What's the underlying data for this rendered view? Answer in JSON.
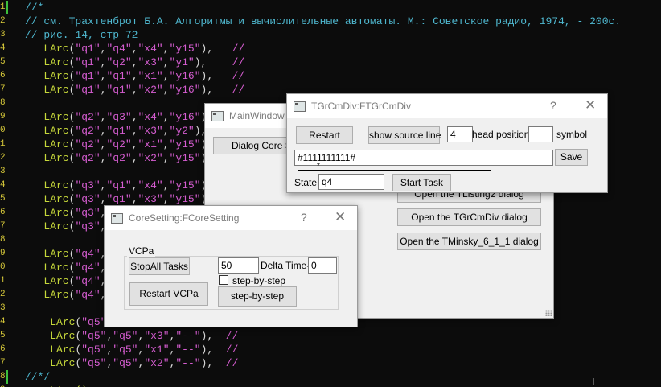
{
  "editor": {
    "lines": [
      {
        "ind": "",
        "t": "cmt",
        "text": "//*"
      },
      {
        "ind": "",
        "t": "cmt",
        "text": "// см. Трахтенброт Б.А. Алгоритмы и вычислительные автоматы. М.: Советское радио, 1974, - 200с."
      },
      {
        "ind": "",
        "t": "cmt",
        "text": "// рис. 14, стр 72"
      },
      {
        "ind": "   ",
        "t": "arc",
        "args": [
          "\"q1\"",
          "\"q4\"",
          "\"x4\"",
          "\"y15\""
        ],
        "sp": "   "
      },
      {
        "ind": "   ",
        "t": "arc",
        "args": [
          "\"q1\"",
          "\"q2\"",
          "\"x3\"",
          "\"y1\""
        ],
        "sp": "    "
      },
      {
        "ind": "   ",
        "t": "arc",
        "args": [
          "\"q1\"",
          "\"q1\"",
          "\"x1\"",
          "\"y16\""
        ],
        "sp": "   "
      },
      {
        "ind": "   ",
        "t": "arc",
        "args": [
          "\"q1\"",
          "\"q1\"",
          "\"x2\"",
          "\"y16\""
        ],
        "sp": "   "
      },
      {
        "ind": "",
        "t": "blank"
      },
      {
        "ind": "   ",
        "t": "arc",
        "args": [
          "\"q2\"",
          "\"q3\"",
          "\"x4\"",
          "\"y16\""
        ],
        "sp": "   "
      },
      {
        "ind": "   ",
        "t": "arc",
        "args": [
          "\"q2\"",
          "\"q1\"",
          "\"x3\"",
          "\"y2\""
        ],
        "sp": "    "
      },
      {
        "ind": "   ",
        "t": "arc",
        "args": [
          "\"q2\"",
          "\"q2\"",
          "\"x1\"",
          "\"y15\""
        ],
        "sp": "   "
      },
      {
        "ind": "   ",
        "t": "arc",
        "args": [
          "\"q2\"",
          "\"q2\"",
          "\"x2\"",
          "\"y15\""
        ],
        "sp": "   "
      },
      {
        "ind": "",
        "t": "blank"
      },
      {
        "ind": "   ",
        "t": "arc",
        "args": [
          "\"q3\"",
          "\"q1\"",
          "\"x4\"",
          "\"y15\""
        ],
        "sp": "   "
      },
      {
        "ind": "   ",
        "t": "arc",
        "args": [
          "\"q3\"",
          "\"q1\"",
          "\"x3\"",
          "\"y15\""
        ],
        "sp": "   "
      },
      {
        "ind": "   ",
        "t": "arc",
        "args": [
          "\"q3\"",
          "\"q3\"",
          "\"x1\"",
          "\"y16\""
        ],
        "sp": "   "
      },
      {
        "ind": "   ",
        "t": "arc",
        "args": [
          "\"q3\"",
          "\"q3\"",
          "\"x2\"",
          "\"y16\""
        ],
        "sp": "   "
      },
      {
        "ind": "",
        "t": "blank"
      },
      {
        "ind": "   ",
        "t": "arc",
        "args": [
          "\"q4\"",
          "\"q5\"",
          "\"x4\"",
          "\"--\""
        ],
        "sp": "   "
      },
      {
        "ind": "   ",
        "t": "arc",
        "args": [
          "\"q4\"",
          "\"q4\"",
          "\"x3\"",
          "\"--\""
        ],
        "sp": "   "
      },
      {
        "ind": "   ",
        "t": "arc",
        "args": [
          "\"q4\"",
          "\"q4\"",
          "\"x1\"",
          "\"--\""
        ],
        "sp": "   "
      },
      {
        "ind": "   ",
        "t": "arc",
        "args": [
          "\"q4\"",
          "\"q4\"",
          "\"x2\"",
          "\"--\""
        ],
        "sp": "   "
      },
      {
        "ind": "",
        "t": "blank"
      },
      {
        "ind": "    ",
        "t": "arc",
        "args": [
          "\"q5\"",
          "\"q5\"",
          "\"x4\"",
          "\"--\""
        ],
        "sp": "  "
      },
      {
        "ind": "    ",
        "t": "arc",
        "args": [
          "\"q5\"",
          "\"q5\"",
          "\"x3\"",
          "\"--\""
        ],
        "sp": "  "
      },
      {
        "ind": "    ",
        "t": "arc",
        "args": [
          "\"q5\"",
          "\"q5\"",
          "\"x1\"",
          "\"--\""
        ],
        "sp": "  "
      },
      {
        "ind": "    ",
        "t": "arc",
        "args": [
          "\"q5\"",
          "\"q5\"",
          "\"x2\"",
          "\"--\""
        ],
        "sp": "  "
      },
      {
        "ind": "",
        "t": "cmt",
        "text": "//*/"
      },
      {
        "ind": "    ",
        "t": "kwline",
        "text": "LArc()"
      }
    ],
    "kw": "LArc",
    "slc": "//"
  },
  "main_window": {
    "title": "MainWindow",
    "dialog_btn": "Dialog  Core Se",
    "btn_listing": "Open the  TListing2 dialog",
    "btn_grcmdiv": "Open the  TGrCmDiv dialog",
    "btn_minsky": "Open the  TMinsky_6_1_1 dialog"
  },
  "grcmdiv": {
    "title": "TGrCmDiv:FTGrCmDiv",
    "help": "?",
    "close": "✕",
    "restart": "Restart",
    "show_source": "show source line",
    "head_value": "4",
    "head_label": "head position",
    "symbol_value": "",
    "symbol_label": "symbol",
    "tape": "#1111111111#",
    "save": "Save",
    "head_marker": "*",
    "state_label": "State",
    "state_value": "q4",
    "start_task": "Start Task"
  },
  "coresetting": {
    "title": "CoreSetting:FCoreSetting",
    "help": "?",
    "close": "✕",
    "group": "VCPa",
    "stopall": "StopAll Tasks",
    "delta_value": "50",
    "delta_label": "Delta Time-",
    "delta_right": "0",
    "step_check_label": "step-by-step",
    "restart_vcpa": "Restart VCPa",
    "step_btn": "step-by-step"
  },
  "colors": {
    "editor_bg": "#0c0c0c",
    "comment": "#4fb8d0",
    "keyword": "#c6d83a",
    "string": "#d65dd1",
    "window_bg": "#f0f0f0"
  }
}
